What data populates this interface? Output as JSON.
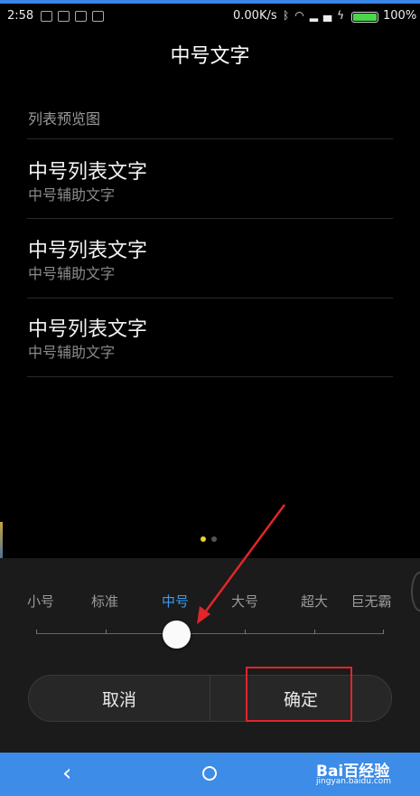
{
  "status_bar": {
    "time": "2:58",
    "network_speed": "0.00K/s",
    "battery_percent": "100%",
    "icons": [
      "notification-icon",
      "notification-icon",
      "notification-icon",
      "notification-icon",
      "bluetooth-icon",
      "wifi-icon",
      "signal-icon",
      "charging-icon",
      "battery-icon"
    ]
  },
  "dialog": {
    "title": "中号文字",
    "preview_label": "列表预览图",
    "preview_items": [
      {
        "title": "中号列表文字",
        "subtitle": "中号辅助文字"
      },
      {
        "title": "中号列表文字",
        "subtitle": "中号辅助文字"
      },
      {
        "title": "中号列表文字",
        "subtitle": "中号辅助文字"
      }
    ],
    "pager": {
      "pages": 2,
      "current": 1
    }
  },
  "font_size_picker": {
    "options": [
      "小号",
      "标准",
      "中号",
      "大号",
      "超大",
      "巨无霸"
    ],
    "selected": "中号",
    "selected_index": 2
  },
  "buttons": {
    "cancel": "取消",
    "confirm": "确定"
  },
  "watermark": {
    "text": "Bai百经验",
    "url": "jingyan.baidu.com"
  },
  "nav_bar": {
    "icons": [
      "back-icon",
      "home-icon"
    ]
  },
  "colors": {
    "accent_blue": "#3d9be9",
    "nav_bar": "#3c8ce8",
    "annotation_red": "#e0262b",
    "pager_active": "#e8d32a"
  }
}
